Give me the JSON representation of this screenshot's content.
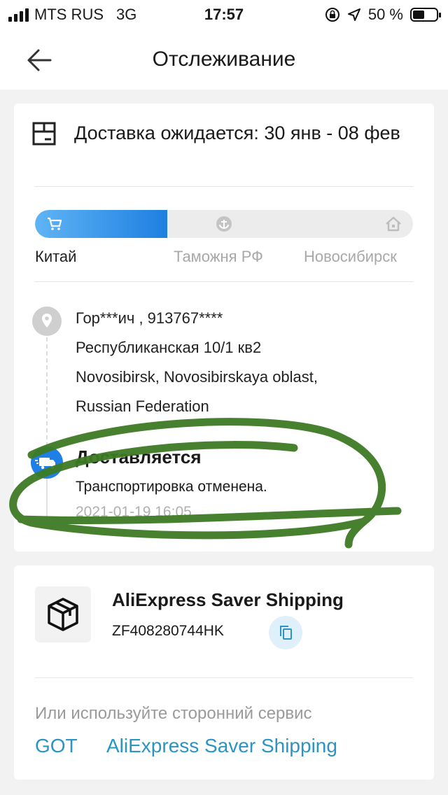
{
  "status_bar": {
    "carrier": "MTS RUS",
    "network": "3G",
    "time": "17:57",
    "battery": "50 %",
    "battery_level": 0.5
  },
  "header": {
    "title": "Отслеживание",
    "back_icon": "arrow-left-icon"
  },
  "delivery": {
    "eta_text": "Доставка ожидается: 30 янв - 08 фев",
    "progress": 0.35,
    "accent_color": "#1e80e6",
    "stages": [
      "Китай",
      "Таможня РФ",
      "Новосибирск"
    ],
    "stage_icons": [
      "cart-icon",
      "anchor-icon",
      "home-icon"
    ]
  },
  "address": {
    "lines": [
      "Гор***ич , 913767****",
      "Республиканская 10/1 кв2",
      "Novosibirsk, Novosibirskaya oblast,",
      "Russian Federation"
    ]
  },
  "tracking_event": {
    "title": "Доставляется",
    "description": "Транспортировка отменена.",
    "timestamp": "2021-01-19 16:05"
  },
  "shipping": {
    "service": "AliExpress Saver Shipping",
    "tracking_number": "ZF408280744HK",
    "alt_label": "Или используйте сторонний сервис",
    "links": [
      "GOT",
      "AliExpress Saver Shipping"
    ],
    "link_color": "#2a94c4"
  },
  "annotation_color": "#3d7a24"
}
